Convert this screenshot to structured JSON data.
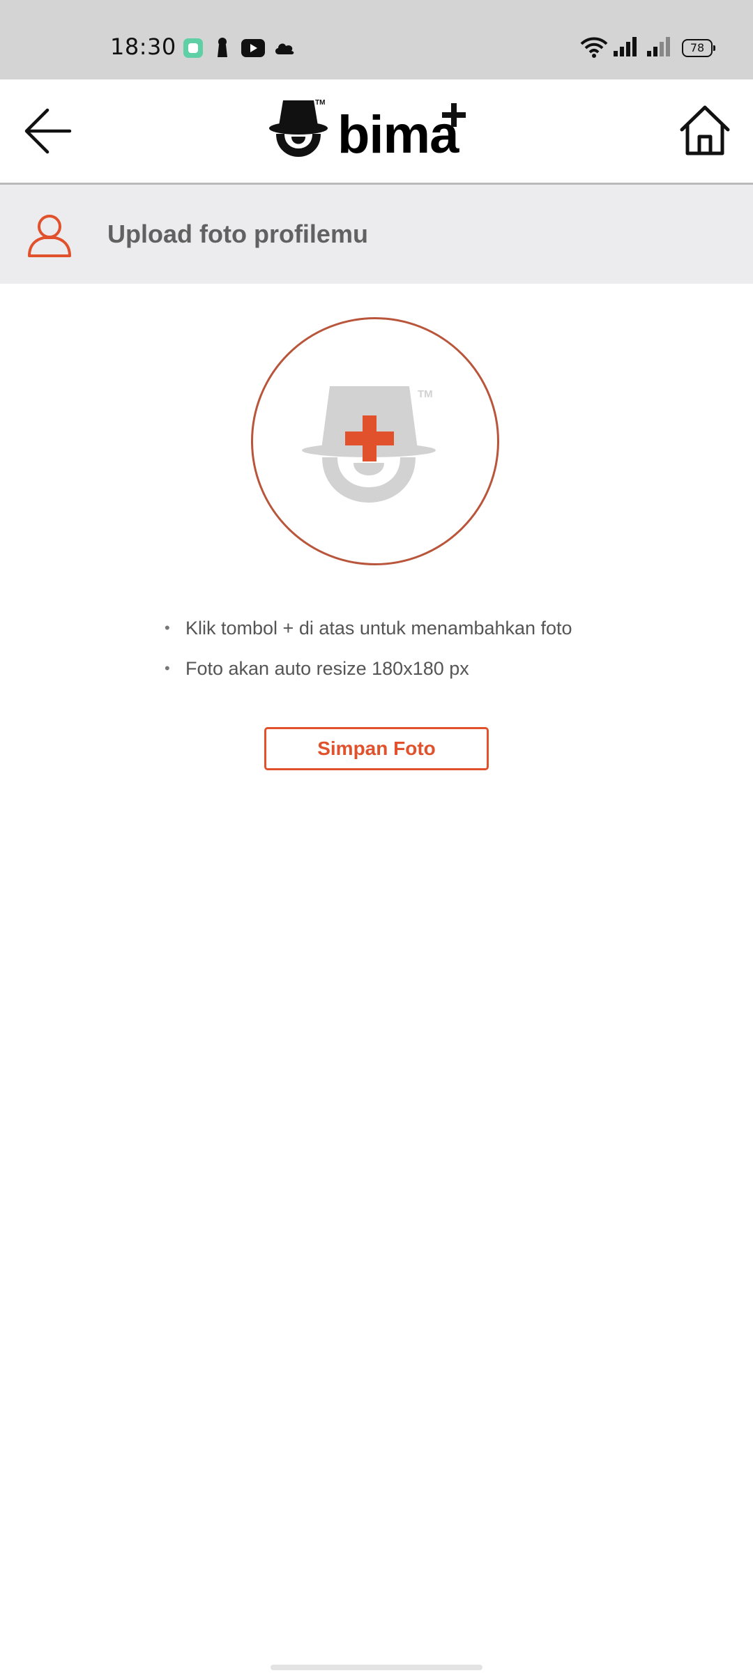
{
  "status_bar": {
    "time": "18:30",
    "battery": "78",
    "icons": [
      "chat-app-icon",
      "keyhole-icon",
      "youtube-icon",
      "cloud-icon",
      "wifi-icon",
      "signal-icon",
      "signal-icon-2",
      "battery-icon"
    ]
  },
  "header": {
    "brand": "bima",
    "brand_suffix": "+",
    "back_icon": "arrow-left-icon",
    "home_icon": "home-icon"
  },
  "section": {
    "title": "Upload foto profilemu",
    "icon": "user-icon"
  },
  "upload": {
    "icon": "add-photo-placeholder-icon",
    "trademark": "TM"
  },
  "instructions": [
    "Klik tombol + di atas untuk menambahkan foto",
    "Foto akan auto resize 180x180 px"
  ],
  "actions": {
    "save_label": "Simpan Foto"
  },
  "colors": {
    "accent": "#e0512c",
    "circle_border": "#b8553a",
    "section_bg": "#ececee",
    "status_bg": "#d4d4d4",
    "placeholder_gray": "#d2d2d2"
  }
}
